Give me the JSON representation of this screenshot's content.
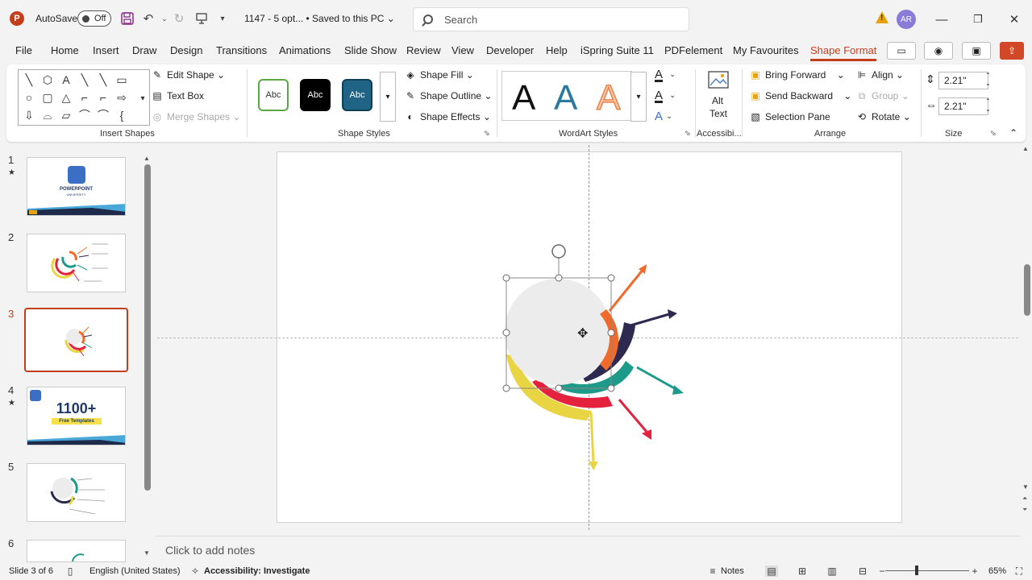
{
  "titlebar": {
    "app_logo": "P",
    "autosave_label": "AutoSave",
    "autosave_state": "Off",
    "doc_title": "1147 - 5 opt... • Saved to this PC",
    "search_placeholder": "Search",
    "user_initials": "AR"
  },
  "menu": {
    "tabs": [
      "File",
      "Home",
      "Insert",
      "Draw",
      "Design",
      "Transitions",
      "Animations",
      "Slide Show",
      "Review",
      "View",
      "Developer",
      "Help",
      "iSpring Suite 11",
      "PDFelement",
      "My Favourites",
      "Shape Format"
    ],
    "active": "Shape Format"
  },
  "ribbon": {
    "insert_shapes": {
      "label": "Insert Shapes",
      "edit_shape": "Edit Shape",
      "text_box": "Text Box",
      "merge_shapes": "Merge Shapes"
    },
    "shape_styles": {
      "label": "Shape Styles",
      "swatch_text": "Abc",
      "shape_fill": "Shape Fill",
      "shape_outline": "Shape Outline",
      "shape_effects": "Shape Effects"
    },
    "wordart": {
      "label": "WordArt Styles",
      "letter": "A"
    },
    "accessibility": {
      "label": "Accessibi...",
      "alt_text_line1": "Alt",
      "alt_text_line2": "Text"
    },
    "arrange": {
      "label": "Arrange",
      "bring_forward": "Bring Forward",
      "send_backward": "Send Backward",
      "selection_pane": "Selection Pane",
      "align": "Align",
      "group": "Group",
      "rotate": "Rotate"
    },
    "size": {
      "label": "Size",
      "height": "2.21\"",
      "width": "2.21\""
    }
  },
  "slides": {
    "numbers": [
      "1",
      "2",
      "3",
      "4",
      "5",
      "6"
    ],
    "active_index": 3,
    "thumb1_title": "POWERPOINT",
    "thumb1_sub": "UNIVERSITY",
    "thumb4_title": "1100+",
    "thumb4_sub": "Free Templates"
  },
  "notes": {
    "placeholder": "Click to add notes"
  },
  "status": {
    "slide_info": "Slide 3 of 6",
    "language": "English (United States)",
    "accessibility": "Accessibility: Investigate",
    "notes": "Notes",
    "zoom": "65%"
  },
  "colors": {
    "accent": "#c43e1c",
    "orange": "#ef6a2b",
    "navy": "#2e2a4f",
    "teal": "#1e9a8a",
    "red": "#e4223d",
    "yellow": "#e9d544",
    "circle": "#ececec"
  }
}
